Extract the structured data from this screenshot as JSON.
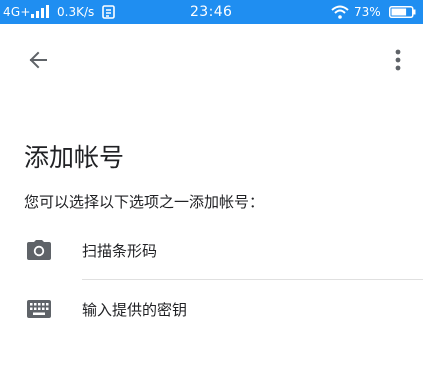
{
  "status_bar": {
    "network": "4G+",
    "speed": "0.3K/s",
    "time": "23:46",
    "battery": "73%",
    "battery_level": 0.73,
    "icons": [
      "signal-icon",
      "sync-icon",
      "wifi-icon",
      "battery-icon"
    ]
  },
  "toolbar": {
    "back_icon": "arrow-back-icon",
    "menu_icon": "more-vert-icon"
  },
  "page": {
    "title": "添加帐号",
    "subtitle": "您可以选择以下选项之一添加帐号："
  },
  "options": [
    {
      "label": "扫描条形码",
      "icon": "camera-icon"
    },
    {
      "label": "输入提供的密钥",
      "icon": "keyboard-icon"
    }
  ],
  "colors": {
    "status_bar": "#1f8ef1",
    "icon": "#5f6368",
    "text": "#202124",
    "divider": "#e0e0e0"
  }
}
